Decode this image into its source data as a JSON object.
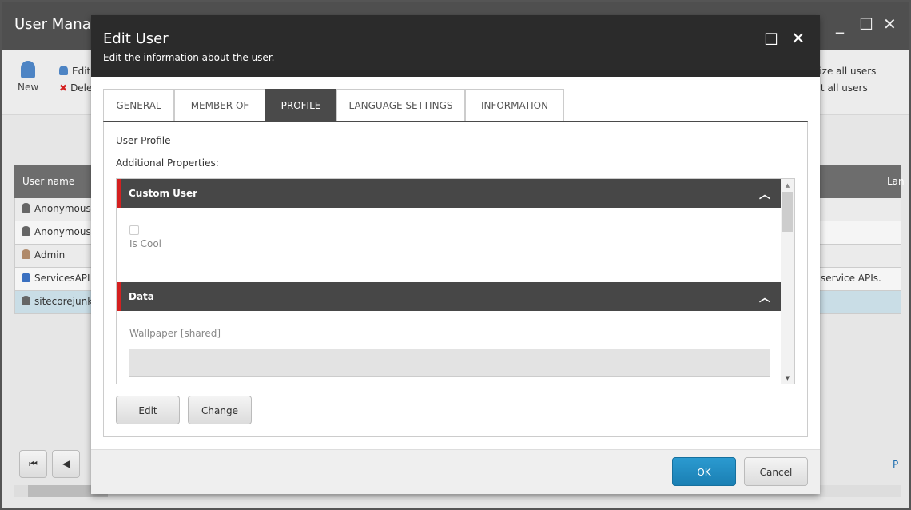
{
  "app": {
    "title": "User Manager",
    "toolbar": {
      "new": "New",
      "edit": "Edit",
      "delete": "Delete",
      "right1": "lize all users",
      "right2": "rt all users"
    },
    "grid": {
      "col_user": "User name",
      "col_lang": "Lan",
      "rows": [
        "Anonymous",
        "Anonymous",
        "Admin",
        "ServicesAPI",
        "sitecorejunkie"
      ],
      "desc_servicesapi": "service APIs."
    },
    "pager_label": "P"
  },
  "dialog": {
    "title": "Edit User",
    "subtitle": "Edit the information about the user.",
    "tabs": [
      "GENERAL",
      "MEMBER OF",
      "PROFILE",
      "LANGUAGE SETTINGS",
      "INFORMATION"
    ],
    "active_tab": "PROFILE",
    "user_profile": "User Profile",
    "additional": "Additional Properties:",
    "sections": [
      {
        "title": "Custom User",
        "field": "Is Cool",
        "checked": false
      },
      {
        "title": "Data",
        "field": "Wallpaper [shared]",
        "value": ""
      }
    ],
    "buttons": {
      "edit": "Edit",
      "change": "Change",
      "ok": "OK",
      "cancel": "Cancel"
    },
    "accent": "#d42020",
    "ok_color": "#1f8ac0"
  }
}
